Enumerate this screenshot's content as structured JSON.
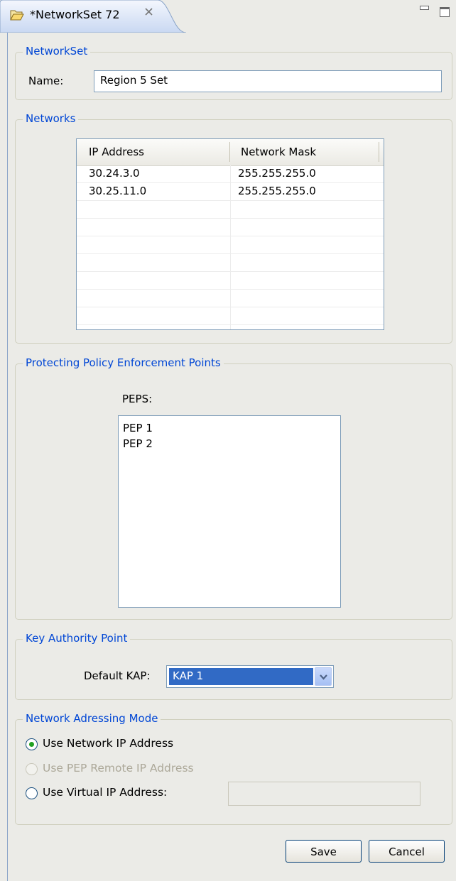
{
  "tab": {
    "title": "*NetworkSet 72",
    "icon": "folder-open-icon",
    "close_icon": "close-icon"
  },
  "networkset": {
    "legend": "NetworkSet",
    "name_label": "Name:",
    "name_value": "Region 5 Set"
  },
  "networks": {
    "legend": "Networks",
    "columns": [
      "IP Address",
      "Network Mask"
    ],
    "rows": [
      [
        "30.24.3.0",
        "255.255.255.0"
      ],
      [
        "30.25.11.0",
        "255.255.255.0"
      ]
    ]
  },
  "peps": {
    "legend": "Protecting Policy Enforcement Points",
    "label": "PEPS:",
    "items": [
      "PEP 1",
      "PEP 2"
    ]
  },
  "kap": {
    "legend": "Key Authority Point",
    "label": "Default KAP:",
    "value": "KAP 1"
  },
  "mode": {
    "legend": "Network Adressing Mode",
    "options": [
      {
        "label": "Use Network IP Address",
        "checked": true,
        "disabled": false
      },
      {
        "label": "Use PEP Remote IP Address",
        "checked": false,
        "disabled": true
      },
      {
        "label": "Use Virtual IP Address:",
        "checked": false,
        "disabled": false
      }
    ],
    "virtual_ip_value": ""
  },
  "buttons": {
    "save": "Save",
    "cancel": "Cancel"
  },
  "colors": {
    "legend": "#0046d5",
    "selection": "#316ac5",
    "radio_checked": "#21a121"
  }
}
